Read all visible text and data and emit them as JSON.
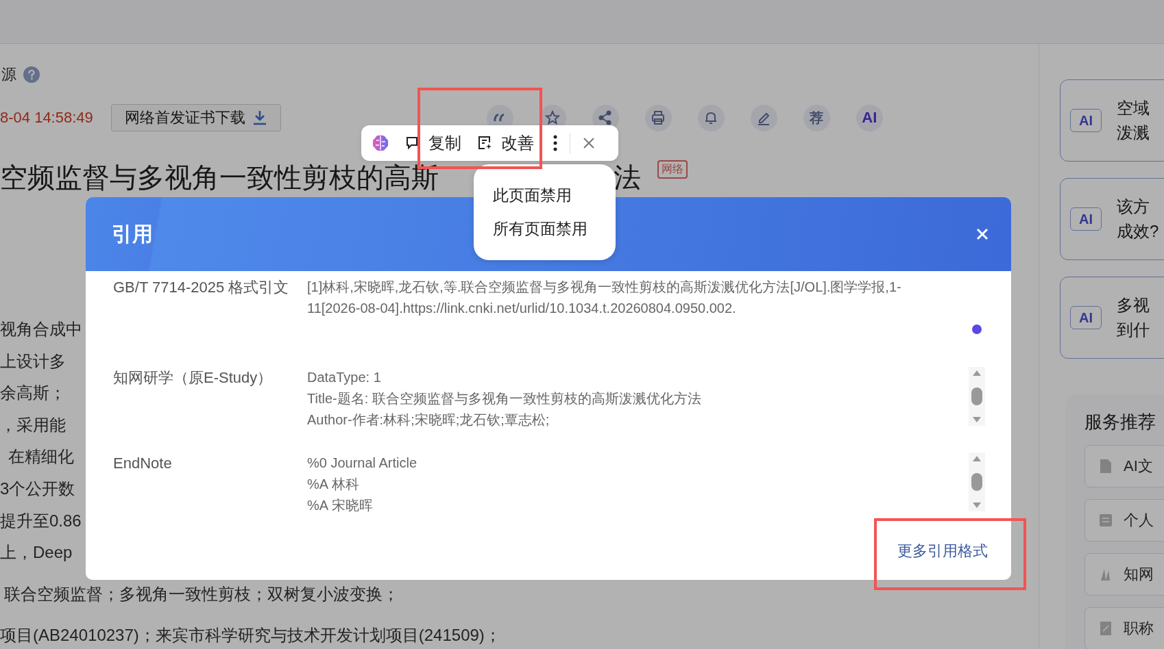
{
  "page": {
    "source_label": "源",
    "timestamp": "8-04 14:58:49",
    "cert_button": "网络首发证书下载",
    "toolbar": [
      {
        "kind": "quote"
      },
      {
        "kind": "star"
      },
      {
        "kind": "share"
      },
      {
        "kind": "print"
      },
      {
        "kind": "bell"
      },
      {
        "kind": "edit"
      },
      {
        "kind": "text",
        "label": "荐"
      },
      {
        "kind": "ai",
        "label": "AI"
      }
    ],
    "title": "空频监督与多视角一致性剪枝的高斯",
    "title_tail": "法",
    "badge": "网络",
    "abstract_lines": [
      "视角合成中",
      "上设计多",
      "余高斯；",
      "，采用能",
      "在精细化",
      "3个公开数",
      "提升至0.86",
      "上，Deep"
    ],
    "keywords": "联合空频监督；多视角一致性剪枝；双树复小波变换；",
    "funding": "项目(AB24010237)；来宾市科学研究与技术开发计划项目(241509)；"
  },
  "sidebar": {
    "ai_questions": [
      {
        "badge": "AI",
        "lines": [
          "空域",
          "泼溅"
        ]
      },
      {
        "badge": "AI",
        "lines": [
          "该方",
          "成效?"
        ]
      },
      {
        "badge": "AI",
        "lines": [
          "多视",
          "到什"
        ]
      }
    ],
    "services": {
      "title": "服务推荐",
      "items": [
        {
          "kind": "ai-doc",
          "label": "AI文"
        },
        {
          "kind": "search",
          "label": "个人"
        },
        {
          "kind": "book",
          "label": "知网"
        },
        {
          "kind": "pen",
          "label": "职称"
        }
      ]
    }
  },
  "selection_toolbar": {
    "actions": [
      {
        "kind": "copy",
        "label": "复制"
      },
      {
        "kind": "improve",
        "label": "改善"
      }
    ]
  },
  "menu": {
    "items": [
      "此页面禁用",
      "所有页面禁用"
    ]
  },
  "dialog": {
    "title": "引用",
    "rows": [
      {
        "label": "GB/T 7714-2025 格式引文",
        "lines": [
          "[1]林科,宋晓晖,龙石钦,等.联合空频监督与多视角一致性剪枝的高斯泼溅优化方法[J/OL].图学学报,1-",
          "11[2026-08-04].https://link.cnki.net/urlid/10.1034.t.20260804.0950.002."
        ],
        "scrollable": false
      },
      {
        "label": "知网研学（原E-Study）",
        "lines": [
          "DataType: 1",
          "Title-题名: 联合空频监督与多视角一致性剪枝的高斯泼溅优化方法",
          "Author-作者:林科;宋晓晖;龙石钦;覃志松;"
        ],
        "scrollable": true
      },
      {
        "label": "EndNote",
        "lines": [
          "%0 Journal Article",
          "%A 林科",
          "%A 宋晓晖"
        ],
        "scrollable": true
      }
    ],
    "more_link": "更多引用格式"
  }
}
